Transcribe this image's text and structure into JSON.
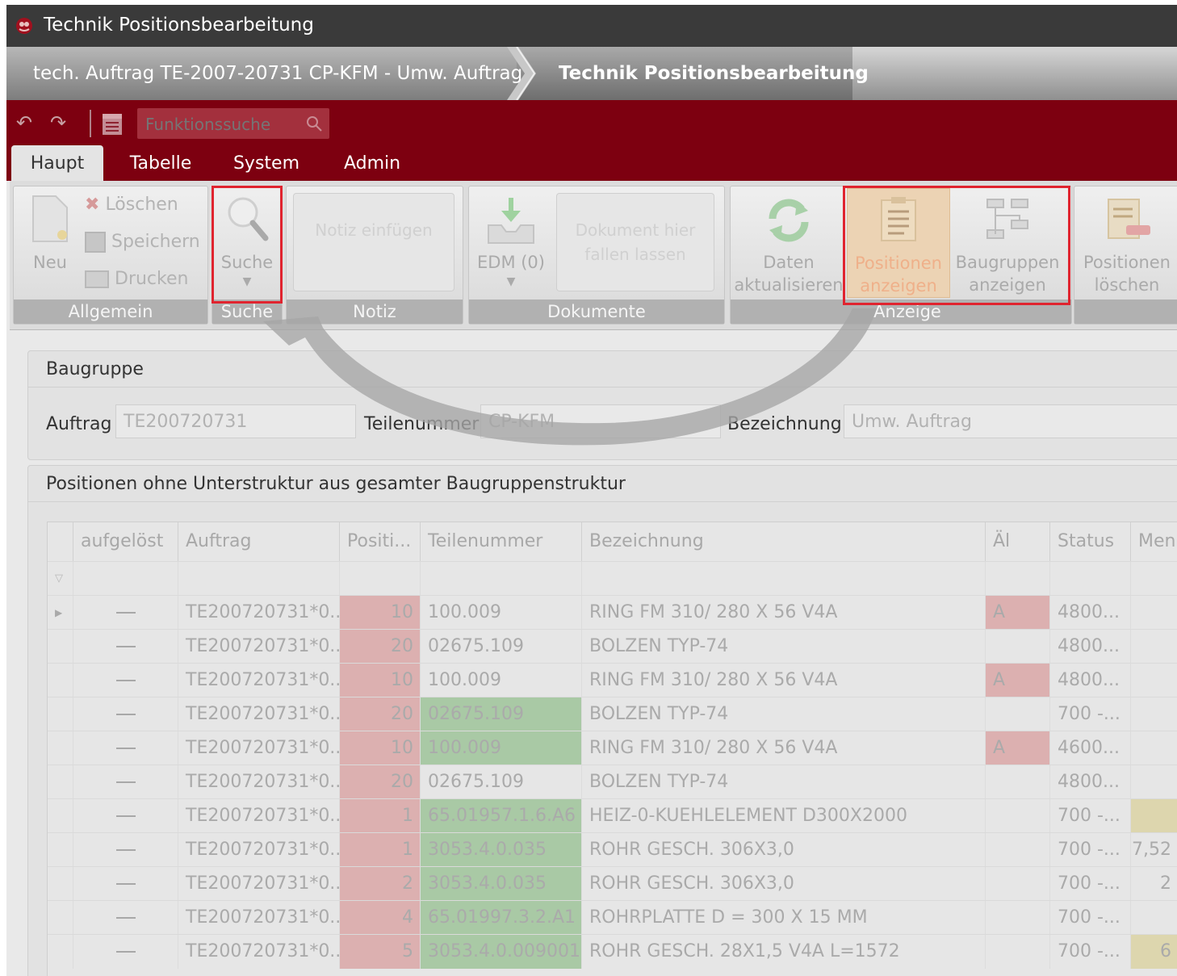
{
  "window": {
    "title": "Technik Positionsbearbeitung"
  },
  "breadcrumb": {
    "items": [
      "tech. Auftrag TE-2007-20731 CP-KFM - Umw. Auftrag",
      "Technik Positionsbearbeitung"
    ]
  },
  "quickbar": {
    "search_placeholder": "Funktionssuche"
  },
  "tabs": [
    "Haupt",
    "Tabelle",
    "System",
    "Admin"
  ],
  "ribbon": {
    "allgemein": {
      "label": "Allgemein",
      "neu": "Neu",
      "loeschen": "Löschen",
      "speichern": "Speichern",
      "drucken": "Drucken"
    },
    "suche": {
      "label": "Suche",
      "button": "Suche"
    },
    "notiz": {
      "label": "Notiz",
      "button": "Notiz einfügen"
    },
    "dokumente": {
      "label": "Dokumente",
      "edm": "EDM (0)",
      "drop": "Dokument hier fallen lassen"
    },
    "daten": {
      "line1": "Daten",
      "line2": "aktualisieren"
    },
    "anzeige": {
      "label": "Anzeige",
      "pos1": "Positionen",
      "pos2": "anzeigen",
      "bg1": "Baugruppen",
      "bg2": "anzeigen"
    },
    "loeschen": {
      "line1": "Positionen",
      "line2": "löschen"
    }
  },
  "baugruppe": {
    "title": "Baugruppe",
    "auftrag_label": "Auftrag",
    "auftrag_value": "TE200720731",
    "teilenummer_label": "Teilenummer",
    "teilenummer_value": "CP-KFM",
    "bezeichnung_label": "Bezeichnung",
    "bezeichnung_value": "Umw. Auftrag"
  },
  "positions": {
    "title": "Positionen ohne Unterstruktur aus gesamter Baugruppenstruktur",
    "columns": [
      "aufgelöst",
      "Auftrag",
      "Positi...",
      "Teilenummer",
      "Bezeichnung",
      "Äl",
      "Status",
      "Men"
    ],
    "rows": [
      {
        "auftrag": "TE200720731*0...",
        "pos": "10",
        "teil": "100.009",
        "bez": "RING FM  310/ 280 X  56    V4A",
        "ae": "A",
        "status": "4800...",
        "men": ""
      },
      {
        "auftrag": "TE200720731*0...",
        "pos": "20",
        "teil": "02675.109",
        "bez": "BOLZEN           TYP-74",
        "ae": "",
        "status": "4800...",
        "men": ""
      },
      {
        "auftrag": "TE200720731*0...",
        "pos": "10",
        "teil": "100.009",
        "bez": "RING FM  310/ 280 X  56    V4A",
        "ae": "A",
        "status": "4800...",
        "men": ""
      },
      {
        "auftrag": "TE200720731*0...",
        "pos": "20",
        "teil": "02675.109",
        "bez": "BOLZEN           TYP-74",
        "ae": "",
        "status": "700 -...",
        "men": ""
      },
      {
        "auftrag": "TE200720731*0...",
        "pos": "10",
        "teil": "100.009",
        "bez": "RING FM  310/ 280 X  56    V4A",
        "ae": "A",
        "status": "4600...",
        "men": ""
      },
      {
        "auftrag": "TE200720731*0...",
        "pos": "20",
        "teil": "02675.109",
        "bez": "BOLZEN           TYP-74",
        "ae": "",
        "status": "4800...",
        "men": ""
      },
      {
        "auftrag": "TE200720731*0...",
        "pos": "1",
        "teil": "65.01957.1.6.A6",
        "bez": "HEIZ-0-KUEHLELEMENT D300X2000",
        "ae": "",
        "status": "700 -...",
        "men": ""
      },
      {
        "auftrag": "TE200720731*0...",
        "pos": "1",
        "teil": "3053.4.0.035",
        "bez": "ROHR GESCH. 306X3,0",
        "ae": "",
        "status": "700 -...",
        "men": "7,52"
      },
      {
        "auftrag": "TE200720731*0...",
        "pos": "2",
        "teil": "3053.4.0.035",
        "bez": "ROHR GESCH. 306X3,0",
        "ae": "",
        "status": "700 -...",
        "men": "2"
      },
      {
        "auftrag": "TE200720731*0...",
        "pos": "4",
        "teil": "65.01997.3.2.A1",
        "bez": "ROHRPLATTE      D = 300 X 15 MM",
        "ae": "",
        "status": "700 -...",
        "men": ""
      },
      {
        "auftrag": "TE200720731*0...",
        "pos": "5",
        "teil": "3053.4.0.009001",
        "bez": "ROHR GESCH.  28X1,5 V4A L=1572",
        "ae": "",
        "status": "700 -...",
        "men": "6"
      }
    ],
    "teil_green": [
      false,
      false,
      false,
      true,
      true,
      false,
      true,
      true,
      true,
      true,
      true
    ],
    "men_yellow": [
      false,
      false,
      false,
      false,
      false,
      false,
      true,
      false,
      false,
      false,
      true
    ]
  },
  "colors": {
    "brand_red": "#7d0010",
    "highlight": "#e0242f"
  }
}
